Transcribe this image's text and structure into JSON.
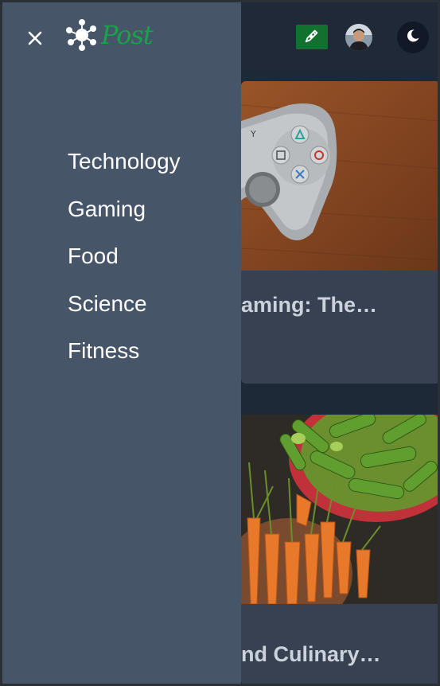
{
  "header": {
    "write_icon": "pen-nib-icon",
    "write_color": "#12712f",
    "avatar_icon": "user-avatar",
    "theme_icon": "moon-icon"
  },
  "drawer": {
    "close_label": "×",
    "logo_text": "Post",
    "logo_color": "#18a34a",
    "menu": [
      {
        "label": "Technology"
      },
      {
        "label": "Gaming"
      },
      {
        "label": "Food"
      },
      {
        "label": "Science"
      },
      {
        "label": "Fitness"
      }
    ]
  },
  "cards": [
    {
      "title": "aming: The…",
      "image": "game-controller-photo"
    },
    {
      "title": "nd Culinary…",
      "image": "vegetables-photo"
    }
  ]
}
